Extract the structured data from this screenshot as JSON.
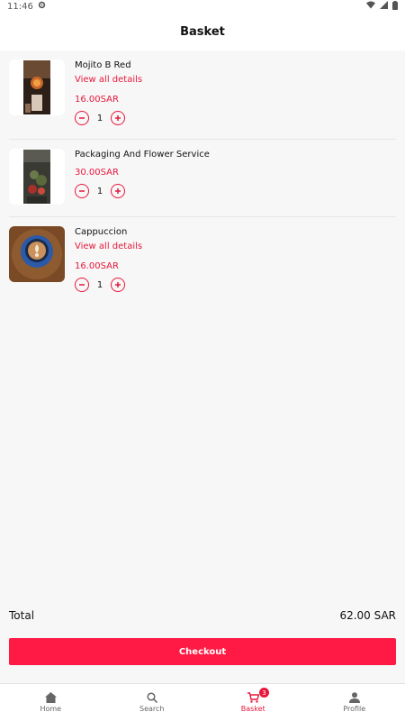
{
  "status": {
    "time": "11:46"
  },
  "header": {
    "title": "Basket"
  },
  "items": [
    {
      "name": "Mojito B Red",
      "link": "View all details",
      "price": "16.00SAR",
      "qty": "1"
    },
    {
      "name": "Packaging And Flower Service",
      "price": "30.00SAR",
      "qty": "1"
    },
    {
      "name": "Cappuccion",
      "link": "View all details",
      "price": "16.00SAR",
      "qty": "1"
    }
  ],
  "summary": {
    "total_label": "Total",
    "total_value": "62.00 SAR",
    "checkout_label": "Checkout"
  },
  "nav": {
    "items": [
      {
        "label": "Home",
        "icon": "home-icon"
      },
      {
        "label": "Search",
        "icon": "search-icon"
      },
      {
        "label": "Basket",
        "icon": "cart-icon",
        "badge": "3"
      },
      {
        "label": "Profile",
        "icon": "person-icon"
      }
    ]
  },
  "colors": {
    "accent": "#e8183c",
    "button": "#ff1a45"
  }
}
